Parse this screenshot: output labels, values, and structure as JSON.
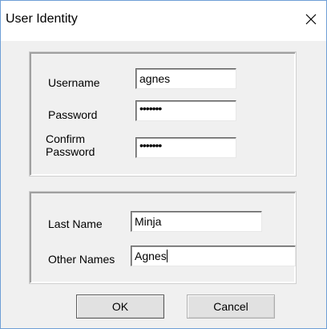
{
  "window": {
    "title": "User Identity",
    "close_icon": "close-icon"
  },
  "credentials": {
    "username_label": "Username",
    "username_value": "agnes",
    "password_label": "Password",
    "password_value": "•••••••",
    "confirm_label_line1": "Confirm",
    "confirm_label_line2": "Password",
    "confirm_value": "•••••••"
  },
  "names": {
    "last_name_label": "Last Name",
    "last_name_value": "Minja",
    "other_names_label": "Other Names",
    "other_names_value": "Agnes"
  },
  "buttons": {
    "ok": "OK",
    "cancel": "Cancel"
  }
}
